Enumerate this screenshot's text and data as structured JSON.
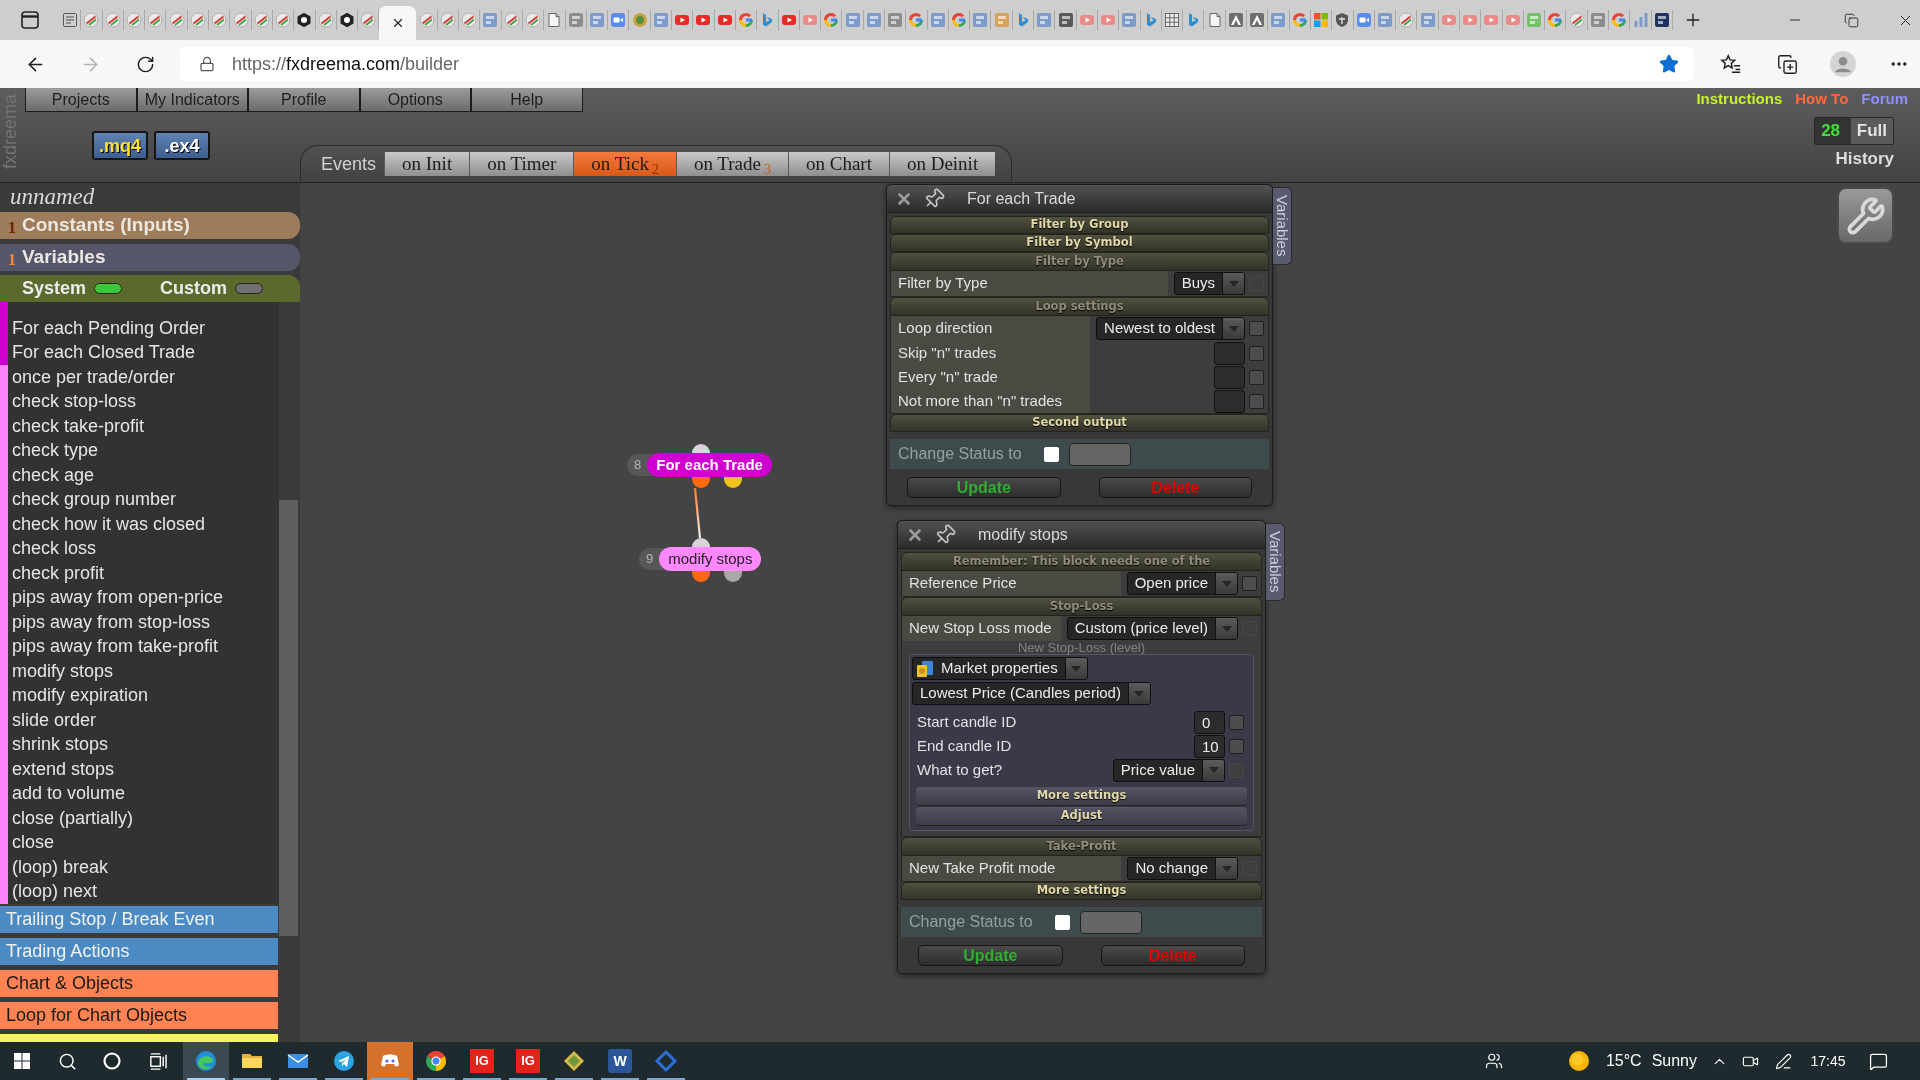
{
  "browser": {
    "tabs": [
      {
        "kind": "list",
        "selected": false
      },
      {
        "kind": "stripes",
        "selected": false
      },
      {
        "kind": "stripes",
        "selected": false
      },
      {
        "kind": "stripes",
        "selected": false
      },
      {
        "kind": "stripes",
        "selected": false
      },
      {
        "kind": "stripes",
        "selected": false
      },
      {
        "kind": "stripes",
        "selected": false
      },
      {
        "kind": "stripes",
        "selected": false
      },
      {
        "kind": "stripes",
        "selected": false
      },
      {
        "kind": "stripes",
        "selected": false
      },
      {
        "kind": "stripes",
        "selected": false
      },
      {
        "kind": "nut",
        "selected": false
      },
      {
        "kind": "stripes",
        "selected": false
      },
      {
        "kind": "nut",
        "selected": false
      },
      {
        "kind": "stripes",
        "selected": false
      },
      {
        "selected": true
      },
      {
        "kind": "stripes",
        "selected": false
      },
      {
        "kind": "stripes",
        "selected": false
      },
      {
        "kind": "stripes",
        "selected": false
      },
      {
        "kind": "tile_blue",
        "selected": false
      },
      {
        "kind": "stripes",
        "selected": false
      },
      {
        "kind": "stripes",
        "selected": false
      },
      {
        "kind": "page",
        "selected": false
      },
      {
        "kind": "tile_gray",
        "selected": false
      },
      {
        "kind": "tile_blue",
        "selected": false
      },
      {
        "kind": "camera",
        "selected": false
      },
      {
        "kind": "emblem",
        "selected": false
      },
      {
        "kind": "tile_blue",
        "selected": false
      },
      {
        "kind": "play",
        "selected": false
      },
      {
        "kind": "play",
        "selected": false
      },
      {
        "kind": "play",
        "selected": false
      },
      {
        "kind": "ring",
        "selected": false
      },
      {
        "kind": "swoosh",
        "selected": false
      },
      {
        "kind": "play",
        "selected": false
      },
      {
        "kind": "play_faded",
        "selected": false
      },
      {
        "kind": "ring",
        "selected": false
      },
      {
        "kind": "tile_blue",
        "selected": false
      },
      {
        "kind": "tile_blue",
        "selected": false
      },
      {
        "kind": "tile_gray",
        "selected": false
      },
      {
        "kind": "ring",
        "selected": false
      },
      {
        "kind": "tile_blue",
        "selected": false
      },
      {
        "kind": "ring",
        "selected": false
      },
      {
        "kind": "tile_blue",
        "selected": false
      },
      {
        "kind": "tile_tan",
        "selected": false
      },
      {
        "kind": "swoosh",
        "selected": false
      },
      {
        "kind": "tile_blue",
        "selected": false
      },
      {
        "kind": "tile_dark",
        "selected": false
      },
      {
        "kind": "play_faded",
        "selected": false
      },
      {
        "kind": "play_faded",
        "selected": false
      },
      {
        "kind": "tile_blue",
        "selected": false
      },
      {
        "kind": "swoosh",
        "selected": false
      },
      {
        "kind": "grid",
        "selected": false
      },
      {
        "kind": "swoosh",
        "selected": false
      },
      {
        "kind": "page",
        "selected": false
      },
      {
        "kind": "peak",
        "selected": false
      },
      {
        "kind": "peak",
        "selected": false
      },
      {
        "kind": "tile_blue",
        "selected": false
      },
      {
        "kind": "ring",
        "selected": false
      },
      {
        "kind": "squares",
        "selected": false
      },
      {
        "kind": "shield",
        "selected": false
      },
      {
        "kind": "camera",
        "selected": false
      },
      {
        "kind": "tile_blue",
        "selected": false
      },
      {
        "kind": "stripes",
        "selected": false
      },
      {
        "kind": "tile_blue",
        "selected": false
      },
      {
        "kind": "play_faded",
        "selected": false
      },
      {
        "kind": "play_faded",
        "selected": false
      },
      {
        "kind": "play_faded",
        "selected": false
      },
      {
        "kind": "play_faded",
        "selected": false
      },
      {
        "kind": "tile_green",
        "selected": false
      },
      {
        "kind": "ring",
        "selected": false
      },
      {
        "kind": "stripes",
        "selected": false
      },
      {
        "kind": "tile_gray",
        "selected": false
      },
      {
        "kind": "ring",
        "selected": false
      },
      {
        "kind": "bars",
        "selected": false
      },
      {
        "kind": "tile_navy",
        "selected": false
      }
    ],
    "back": {
      "disabled": false
    },
    "forward": {
      "disabled": true
    },
    "address": {
      "scheme": "https://",
      "host": "fxdreema.com",
      "path": "/builder"
    },
    "bookmarked": true
  },
  "app": {
    "logo": "fxdreema",
    "menu": [
      "Projects",
      "My Indicators",
      "Profile",
      "Options",
      "Help"
    ],
    "exports": [
      {
        "label": ".mq4",
        "kind": "source"
      },
      {
        "label": ".ex4",
        "kind": "compiled"
      }
    ],
    "links": [
      {
        "label": "Instructions",
        "color": "#c6f02c"
      },
      {
        "label": "How To",
        "color": "#ff6a3d"
      },
      {
        "label": "Forum",
        "color": "#8f8fff"
      }
    ],
    "history": {
      "count": "28",
      "mode": "Full",
      "label": "History"
    },
    "events": {
      "label": "Events",
      "tabs": [
        {
          "label": "on Init",
          "selected": false
        },
        {
          "label": "on Timer",
          "selected": false
        },
        {
          "label": "on Tick",
          "count": "2",
          "selected": true
        },
        {
          "label": "on Trade",
          "count": "3",
          "selected": false
        },
        {
          "label": "on Chart",
          "selected": false
        },
        {
          "label": "on Deinit",
          "selected": false
        }
      ]
    }
  },
  "sidebar": {
    "project_name": "unnamed",
    "sections": [
      {
        "count": "1",
        "label": "Constants (Inputs)",
        "color": "#9d7b5b"
      },
      {
        "count": "1",
        "label": "Variables",
        "color": "#56566b"
      }
    ],
    "toggles": [
      {
        "label": "System",
        "on": true
      },
      {
        "label": "Custom",
        "on": false
      }
    ],
    "blocks": [
      {
        "label": "For each Pending Order",
        "color": "#d100d1"
      },
      {
        "label": "For each Closed Trade",
        "color": "#d100d1"
      },
      {
        "label": "once per trade/order",
        "color": "#ff85ff"
      },
      {
        "label": "check stop-loss",
        "color": "#ff85ff"
      },
      {
        "label": "check take-profit",
        "color": "#ff85ff"
      },
      {
        "label": "check type",
        "color": "#ff85ff"
      },
      {
        "label": "check age",
        "color": "#ff85ff"
      },
      {
        "label": "check group number",
        "color": "#ff85ff"
      },
      {
        "label": "check how it was closed",
        "color": "#ff85ff"
      },
      {
        "label": "check loss",
        "color": "#ff85ff"
      },
      {
        "label": "check profit",
        "color": "#ff85ff"
      },
      {
        "label": "pips away from open-price",
        "color": "#ff85ff"
      },
      {
        "label": "pips away from stop-loss",
        "color": "#ff85ff"
      },
      {
        "label": "pips away from take-profit",
        "color": "#ff85ff"
      },
      {
        "label": "modify stops",
        "color": "#ff85ff"
      },
      {
        "label": "modify expiration",
        "color": "#ff85ff"
      },
      {
        "label": "slide order",
        "color": "#ff85ff"
      },
      {
        "label": "shrink stops",
        "color": "#ff85ff"
      },
      {
        "label": "extend stops",
        "color": "#ff85ff"
      },
      {
        "label": "add to volume",
        "color": "#ff85ff"
      },
      {
        "label": "close (partially)",
        "color": "#ff85ff"
      },
      {
        "label": "close",
        "color": "#ff85ff"
      },
      {
        "label": "(loop) break",
        "color": "#ff85ff"
      },
      {
        "label": "(loop) next",
        "color": "#ff85ff"
      }
    ],
    "categories": [
      {
        "label": "Trailing Stop / Break Even",
        "color": "#4b8ac3"
      },
      {
        "label": "Trading Actions",
        "color": "#4b8ac3"
      },
      {
        "label": "Chart & Objects",
        "color": "#ff8352"
      },
      {
        "label": "Loop for Chart Objects",
        "color": "#ff8352"
      },
      {
        "color": "#f5f55a"
      }
    ]
  },
  "canvas": {
    "nodes": [
      {
        "number": "8",
        "label": "For each Trade",
        "color": "#cf00cf",
        "outputs": [
          {
            "color": "#ff6a10"
          },
          {
            "color": "#f2c31a"
          }
        ]
      },
      {
        "number": "9",
        "label": "modify stops",
        "color": "#ff88ff",
        "outputs": [
          {
            "color": "#ff6a10"
          },
          {
            "color": "#a8a8a8"
          }
        ]
      }
    ],
    "panels": [
      {
        "title": "For each Trade",
        "side_tab": "Variables",
        "sections": [
          {
            "title": "Filter by Group",
            "expanded": false
          },
          {
            "title": "Filter by Symbol",
            "expanded": false
          },
          {
            "title": "Filter by Type",
            "expanded": true,
            "rows": [
              {
                "kind": "select",
                "label": "Filter by Type",
                "value": "Buys",
                "option_disabled": true
              }
            ]
          },
          {
            "title": "Loop settings",
            "expanded": true,
            "rows": [
              {
                "kind": "select",
                "label": "Loop direction",
                "value": "Newest to oldest",
                "option_disabled": false
              },
              {
                "kind": "number",
                "label": "Skip \"n\" trades",
                "option_disabled": false
              },
              {
                "kind": "number",
                "label": "Every \"n\" trade",
                "option_disabled": false
              },
              {
                "kind": "number",
                "label": "Not more than \"n\" trades",
                "option_disabled": false
              }
            ]
          },
          {
            "title": "Second output",
            "expanded": false
          }
        ],
        "status": {
          "label": "Change Status to",
          "checked": false
        },
        "buttons": [
          {
            "kind": "update",
            "label": "Update"
          },
          {
            "kind": "delete",
            "label": "Delete"
          }
        ]
      },
      {
        "title": "modify stops",
        "side_tab": "Variables",
        "sections": [
          {
            "title": "Remember: This block needs one of the",
            "expanded": true,
            "rows": [
              {
                "kind": "select",
                "label": "Reference Price",
                "value": "Open price",
                "option_disabled": false
              }
            ]
          },
          {
            "title": "Stop-Loss",
            "expanded": true,
            "rows": [
              {
                "kind": "select",
                "label": "New Stop Loss mode",
                "value": "Custom (price level)",
                "option_disabled": true
              },
              {
                "kind": "group",
                "caption": "New Stop-Loss (level)",
                "source": "Market properties",
                "function": "Lowest Price (Candles period)",
                "params": [
                  {
                    "kind": "number",
                    "label": "Start candle ID",
                    "value": "0",
                    "option_disabled": false
                  },
                  {
                    "kind": "number",
                    "label": "End candle ID",
                    "value": "10",
                    "option_disabled": false
                  },
                  {
                    "kind": "select",
                    "label": "What to get?",
                    "value": "Price value",
                    "option_disabled": true
                  }
                ],
                "sections": [
                  {
                    "title": "More settings",
                    "expanded": false
                  },
                  {
                    "title": "Adjust",
                    "expanded": false
                  }
                ]
              }
            ]
          },
          {
            "title": "Take-Profit",
            "expanded": true,
            "rows": [
              {
                "kind": "select",
                "label": "New Take Profit mode",
                "value": "No change",
                "option_disabled": true
              }
            ]
          },
          {
            "title": "More settings",
            "expanded": false
          }
        ],
        "status": {
          "label": "Change Status to",
          "checked": false
        },
        "buttons": [
          {
            "kind": "update",
            "label": "Update"
          },
          {
            "kind": "delete",
            "label": "Delete"
          }
        ]
      }
    ]
  },
  "taskbar": {
    "apps": [
      {
        "kind": "swirl",
        "selected": true,
        "flashing": false,
        "running": true
      },
      {
        "kind": "folder",
        "selected": false,
        "flashing": false,
        "running": true
      },
      {
        "kind": "envelope",
        "selected": false,
        "flashing": false,
        "running": true
      },
      {
        "kind": "plane",
        "selected": false,
        "flashing": false,
        "running": true
      },
      {
        "kind": "controller",
        "selected": false,
        "flashing": true,
        "running": true
      },
      {
        "kind": "ring",
        "selected": false,
        "flashing": false,
        "running": true
      },
      {
        "kind": "logo_red",
        "label": "IG",
        "selected": false,
        "flashing": false,
        "running": true
      },
      {
        "kind": "logo_red",
        "label": "IG",
        "selected": false,
        "flashing": false,
        "running": true
      },
      {
        "kind": "diamond",
        "selected": false,
        "flashing": false,
        "running": true
      },
      {
        "kind": "logo_blue",
        "label": "W",
        "selected": false,
        "flashing": false,
        "running": true
      },
      {
        "kind": "diamond_blue",
        "selected": false,
        "flashing": false,
        "running": true
      }
    ],
    "weather": {
      "temperature": "15°C",
      "condition": "Sunny"
    },
    "time": "17:45"
  }
}
